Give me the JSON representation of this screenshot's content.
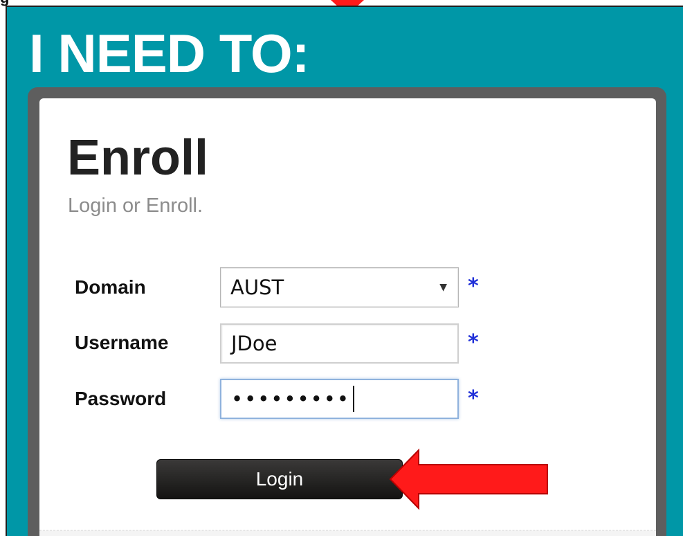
{
  "page": {
    "top_caption": "g"
  },
  "panel": {
    "title": "I NEED TO:"
  },
  "card": {
    "heading": "Enroll",
    "subheading": "Login or Enroll."
  },
  "form": {
    "domain": {
      "label": "Domain",
      "value": "AUST",
      "required_mark": "*"
    },
    "username": {
      "label": "Username",
      "value": "JDoe",
      "required_mark": "*"
    },
    "password": {
      "label": "Password",
      "masked_value": "•••••••••",
      "required_mark": "*"
    },
    "login_button": "Login"
  },
  "colors": {
    "panel_teal": "#0097a7",
    "required_blue": "#1f2fd8",
    "arrow_red": "#ff1a1a"
  }
}
